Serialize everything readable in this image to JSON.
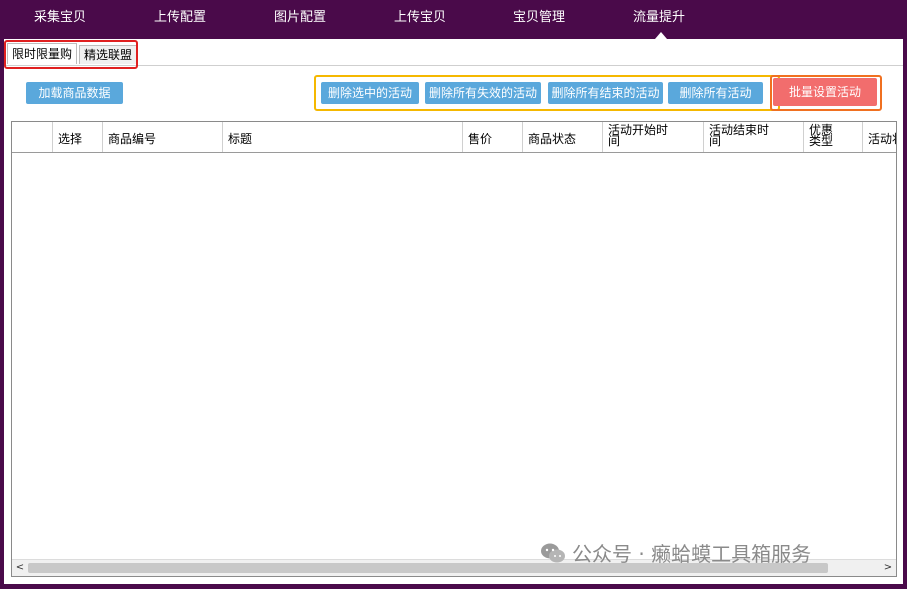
{
  "nav": {
    "items": [
      "采集宝贝",
      "上传配置",
      "图片配置",
      "上传宝贝",
      "宝贝管理",
      "流量提升"
    ],
    "active_index": 5
  },
  "tabs": [
    "限时限量购",
    "精选联盟"
  ],
  "toolbar": {
    "load_label": "加载商品数据",
    "delete_selected_label": "删除选中的活动",
    "delete_invalid_label": "删除所有失效的活动",
    "delete_ended_label": "删除所有结束的活动",
    "delete_all_label": "删除所有活动",
    "batch_set_label": "批量设置活动"
  },
  "grid": {
    "columns": [
      "",
      "选择",
      "商品编号",
      "标题",
      "售价",
      "商品状态",
      "活动开始时间",
      "活动结束时间",
      "优惠类型",
      "活动状"
    ],
    "rows": []
  },
  "scrollbar": {
    "left_arrow": "<",
    "right_arrow": ">"
  },
  "watermark": {
    "text": "公众号 · 癞蛤蟆工具箱服务"
  },
  "colors": {
    "nav_bg": "#4a0a4a",
    "button_blue": "#5aa8dc",
    "button_red": "#f26d6d",
    "highlight_red": "#e02020",
    "highlight_yellow": "#f5b800"
  }
}
